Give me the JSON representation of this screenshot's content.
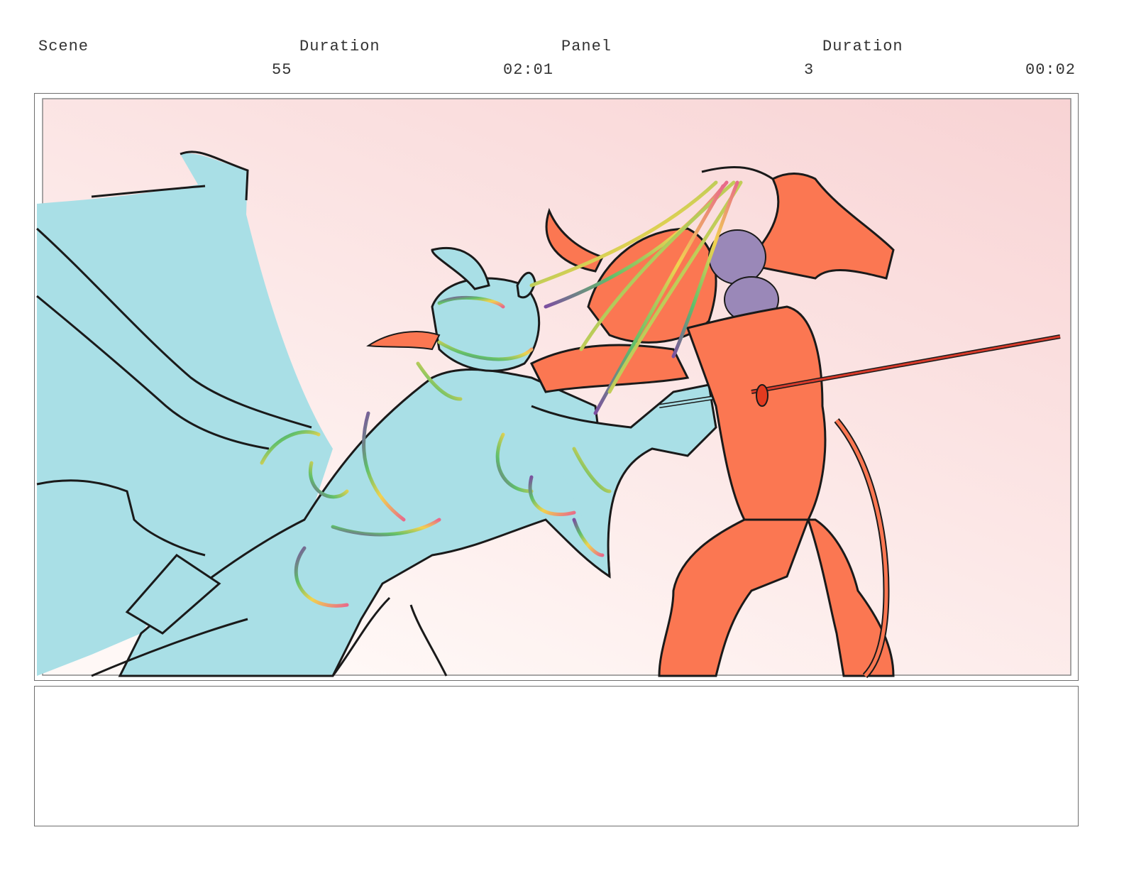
{
  "header": {
    "scene_label": "Scene",
    "scene_duration_label": "Duration",
    "panel_label": "Panel",
    "panel_duration_label": "Duration",
    "scene_value": "55",
    "scene_duration_value": "02:01",
    "panel_value": "3",
    "panel_duration_value": "00:02"
  },
  "artwork": {
    "background_top_color": "#f8d3d4",
    "background_bottom_color": "#fff8f6",
    "left_figure_color": "#a9dfe6",
    "right_figure_color": "#fb7752",
    "accent_purple": "#9a88b8",
    "line_color": "#1a1a1a"
  },
  "notes": {
    "text": ""
  }
}
